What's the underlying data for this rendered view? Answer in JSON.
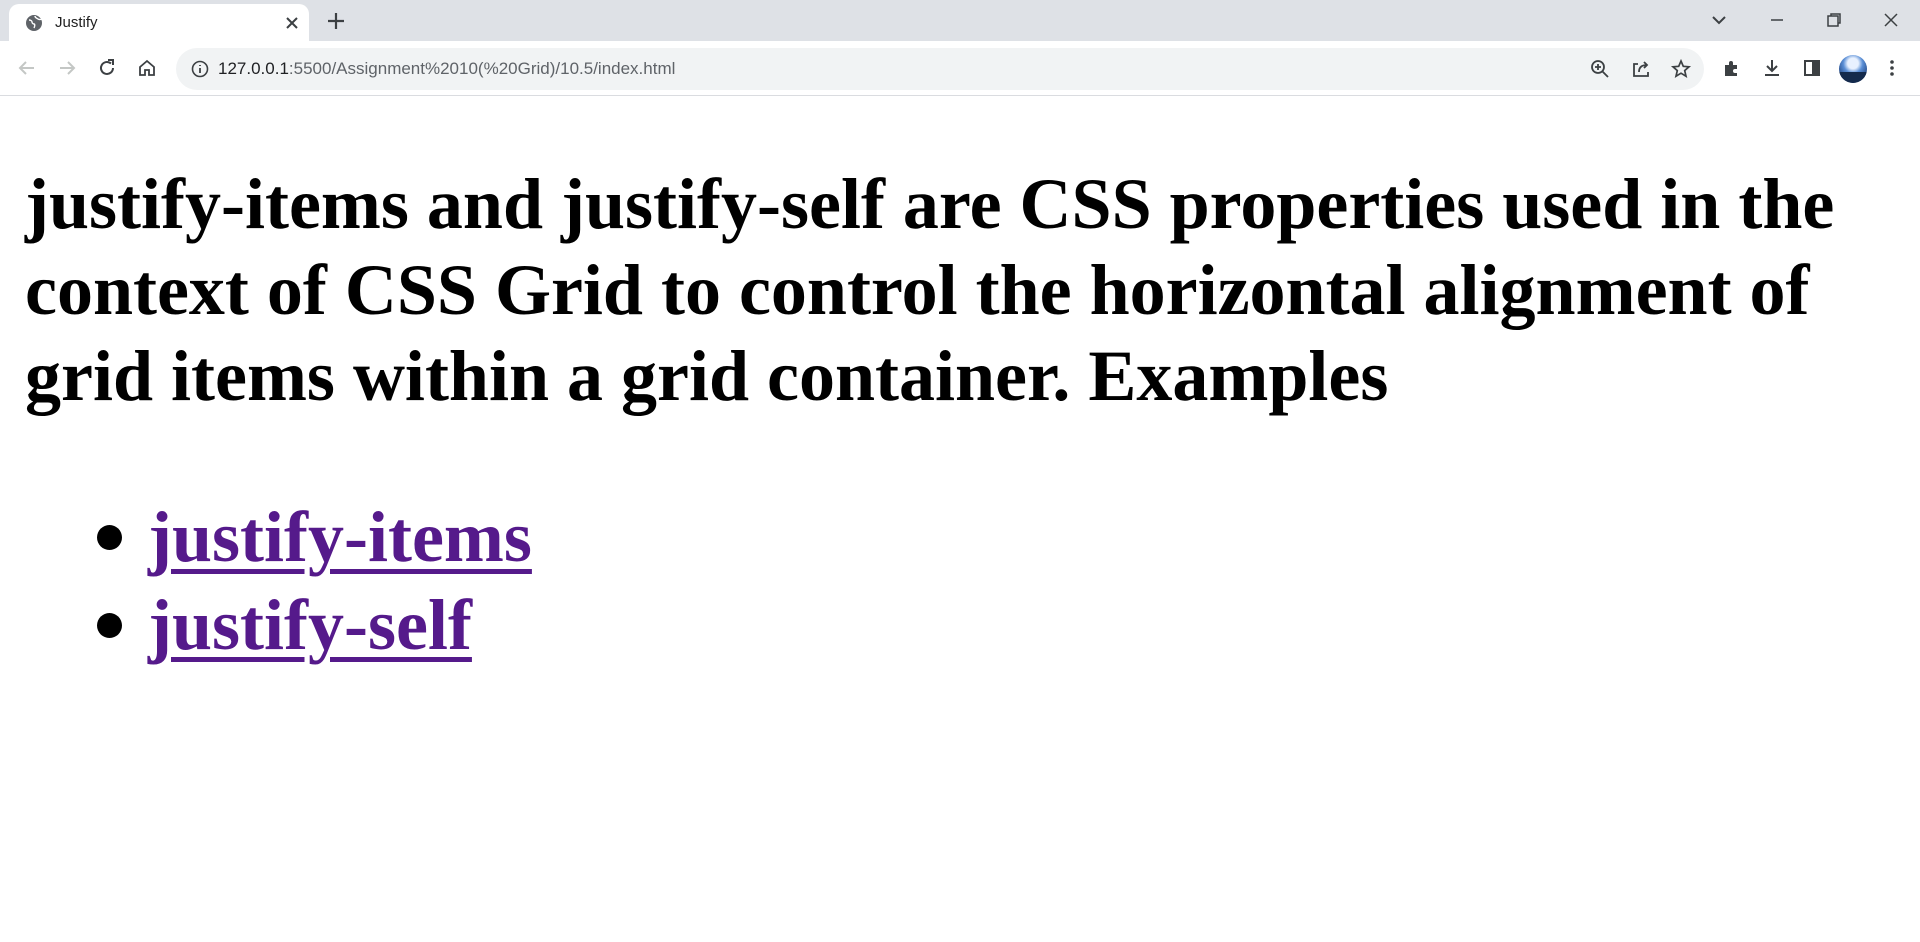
{
  "browser": {
    "tab": {
      "title": "Justify",
      "favicon": "globe-icon"
    },
    "address_bar": {
      "url_host": "127.0.0.1",
      "url_rest": ":5500/Assignment%2010(%20Grid)/10.5/index.html"
    },
    "icons": {
      "back": "arrow-left-icon",
      "forward": "arrow-right-icon",
      "reload": "reload-icon",
      "home": "home-icon",
      "zoom": "zoom-icon",
      "share": "share-icon",
      "bookmark": "star-icon",
      "extensions": "puzzle-icon",
      "downloads": "download-icon",
      "side_panel": "side-panel-icon",
      "menu": "more-vert-icon"
    },
    "colors": {
      "tabstrip": "#dee1e6",
      "omnibox": "#f1f3f4",
      "visited_link": "#551a8b"
    }
  },
  "page": {
    "heading": "justify-items and justify-self are CSS properties used in the context of CSS Grid to control the horizontal alignment of grid items within a grid container. Examples",
    "links": [
      {
        "label": "justify-items"
      },
      {
        "label": "justify-self"
      }
    ]
  }
}
